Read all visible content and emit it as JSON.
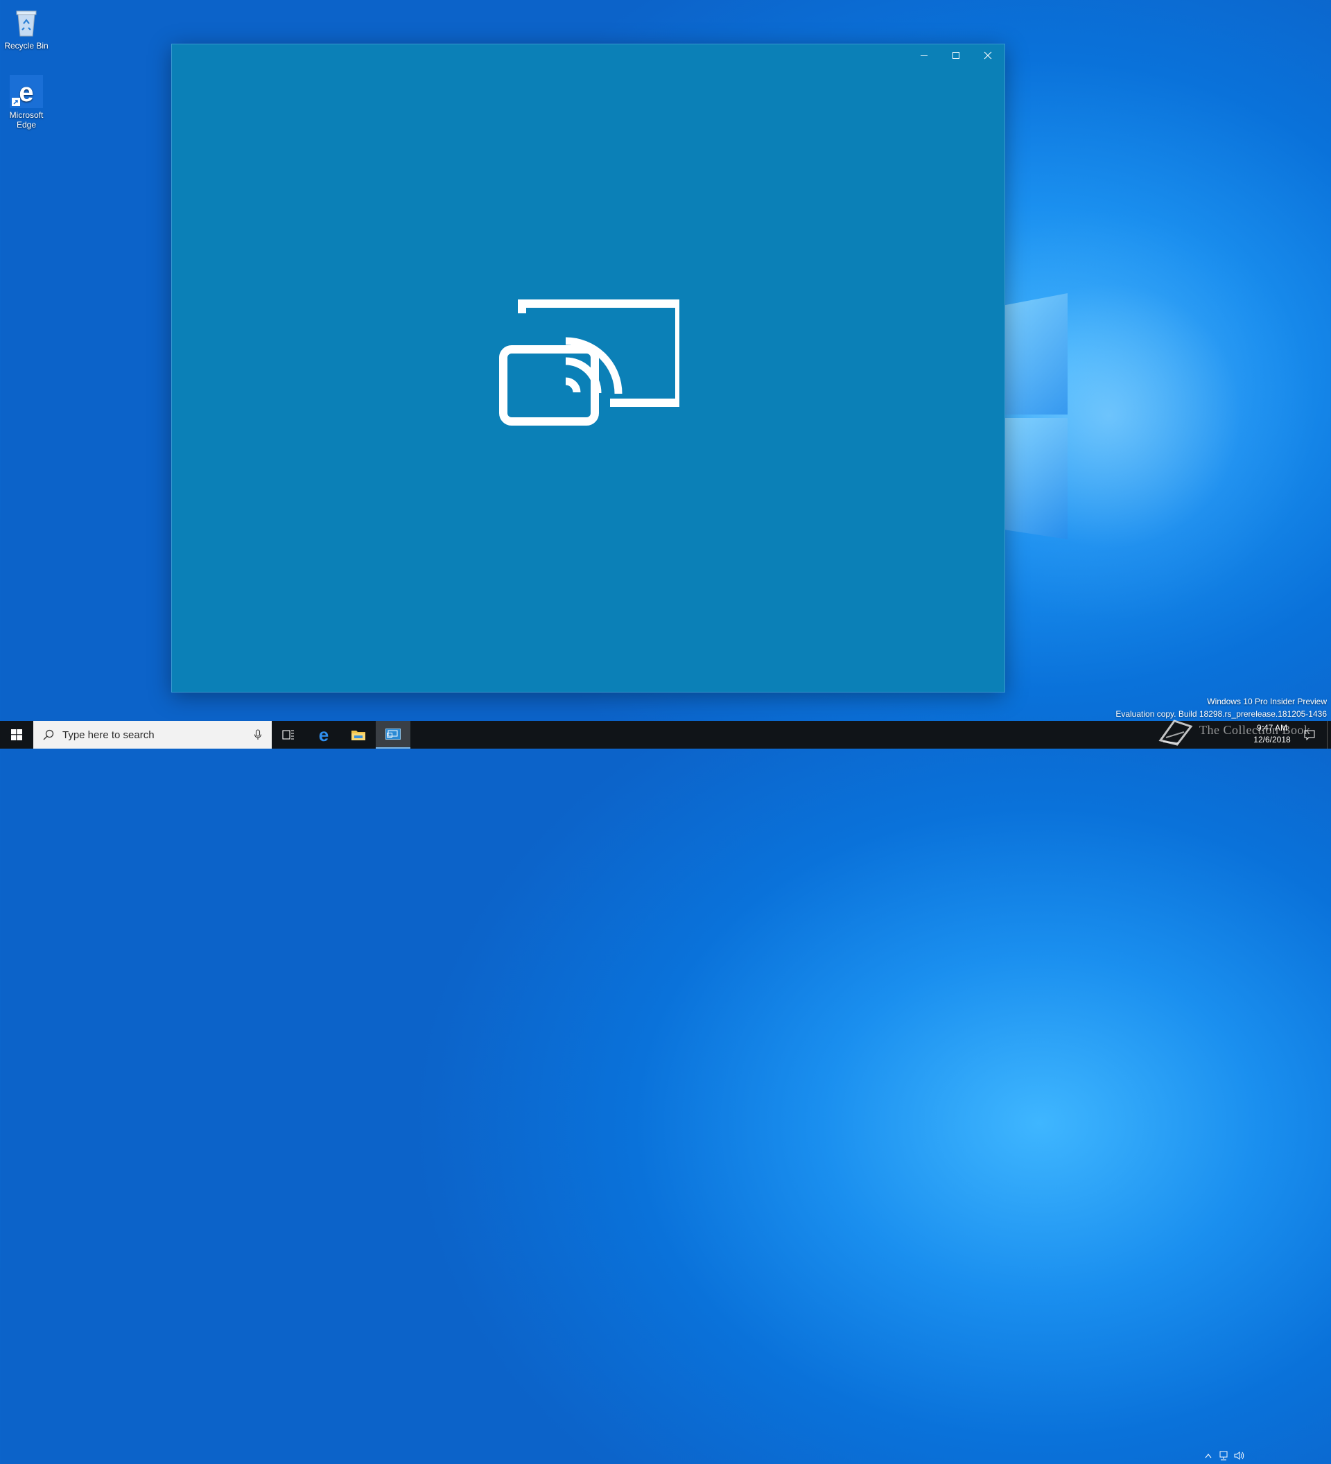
{
  "desktop": {
    "icons": [
      {
        "label": "Recycle Bin"
      },
      {
        "label": "Microsoft Edge"
      }
    ]
  },
  "window": {
    "background": "#0b80b7",
    "controls": {
      "minimize": "minimize-icon",
      "maximize": "maximize-icon",
      "close": "close-icon"
    },
    "content_icon": "connect-cast-icon"
  },
  "taskbar": {
    "search_placeholder": "Type here to search",
    "pinned": [
      "task-view-icon",
      "edge-icon",
      "file-explorer-icon",
      "connect-app-icon"
    ],
    "clock": {
      "time": "9:47 AM",
      "date": "12/6/2018"
    }
  },
  "watermark": {
    "line1": "Windows 10 Pro Insider Preview",
    "line2": "Evaluation copy. Build 18298.rs_prerelease.181205-1436"
  },
  "overlay": {
    "text": "The Collection Book"
  }
}
